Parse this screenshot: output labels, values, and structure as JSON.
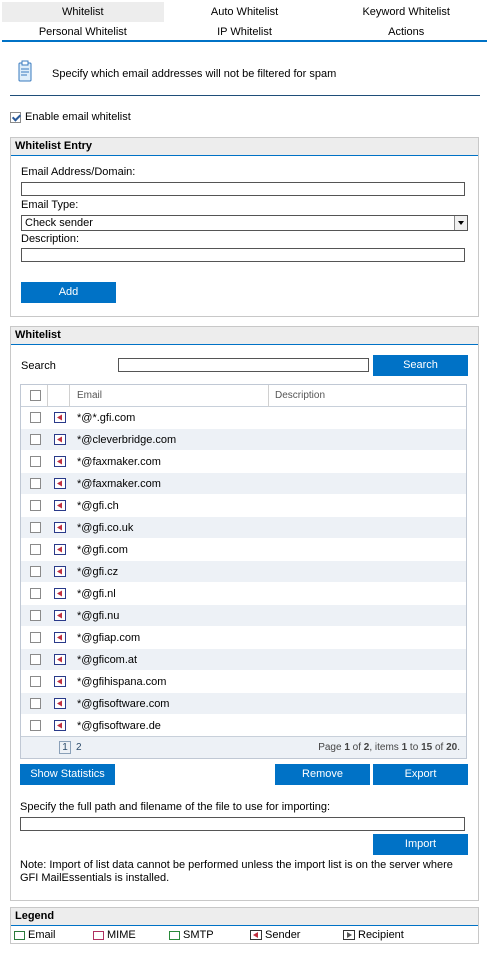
{
  "tabs_top": [
    "Whitelist",
    "Auto Whitelist",
    "Keyword Whitelist"
  ],
  "tabs_sub": [
    "Personal Whitelist",
    "IP Whitelist",
    "Actions"
  ],
  "info_text": "Specify which email addresses will not be filtered for spam",
  "enable_label": "Enable email whitelist",
  "entry": {
    "title": "Whitelist Entry",
    "email_label": "Email Address/Domain:",
    "email_value": "",
    "type_label": "Email Type:",
    "type_value": "Check sender",
    "desc_label": "Description:",
    "desc_value": "",
    "add_button": "Add"
  },
  "whitelist": {
    "title": "Whitelist",
    "search_label": "Search",
    "search_value": "",
    "search_button": "Search",
    "columns": [
      "Email",
      "Description"
    ],
    "rows": [
      "*@*.gfi.com",
      "*@cleverbridge.com",
      "*@faxmaker.com",
      "*@faxmaker.com",
      "*@gfi.ch",
      "*@gfi.co.uk",
      "*@gfi.com",
      "*@gfi.cz",
      "*@gfi.nl",
      "*@gfi.nu",
      "*@gfiap.com",
      "*@gficom.at",
      "*@gfihispana.com",
      "*@gfisoftware.com",
      "*@gfisoftware.de"
    ],
    "pages": [
      "1",
      "2"
    ],
    "page_info_pre": "Page ",
    "page_current": "1",
    "page_info_mid": " of ",
    "page_total": "2",
    "page_info_items": ", items ",
    "items_from": "1",
    "items_to_word": " to ",
    "items_to": "15",
    "items_of_word": " of ",
    "items_total": "20",
    "items_end": "."
  },
  "buttons": {
    "show_statistics": "Show Statistics",
    "remove": "Remove",
    "export": "Export",
    "import": "Import"
  },
  "import_label": "Specify the full path and filename of the file to use for importing:",
  "import_value": "",
  "note": "Note: Import of list data cannot be performed unless the import list is on the server where GFI MailEssentials is installed.",
  "legend": {
    "title": "Legend",
    "items": [
      "Email",
      "MIME",
      "SMTP",
      "Sender",
      "Recipient"
    ]
  },
  "colors": {
    "accent": "#0072c6",
    "tab_active_bg": "#ededed",
    "row_alt": "#edf1f6"
  }
}
